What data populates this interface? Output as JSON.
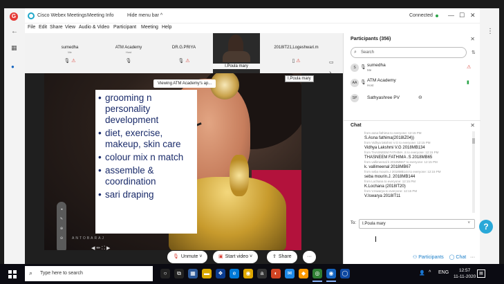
{
  "window": {
    "app_title": "Cisco Webex Meetings",
    "meeting_info": "Meeting Info",
    "hide_menu": "Hide menu bar ^",
    "connection": "Connected",
    "minimize": "—",
    "maximize": "☐",
    "close": "✕"
  },
  "menu": [
    "File",
    "Edit",
    "Share",
    "View",
    "Audio & Video",
    "Participant",
    "Meeting",
    "Help"
  ],
  "thumbnails": [
    {
      "name": "sumedha",
      "role": "Me"
    },
    {
      "name": "ATM Academy",
      "role": "Host"
    },
    {
      "name": "DR.G.PRIYA",
      "role": ""
    },
    {
      "name": "I.Poula mary",
      "role": ""
    },
    {
      "name": "2018IT21,Logeshwari.m",
      "role": ""
    }
  ],
  "stage": {
    "viewing_banner": "Viewing ATM Academy's ap...",
    "hover_tip": "I.Poula mary",
    "watermark": "ANTOBARAJ"
  },
  "slide": {
    "bullets": [
      "grooming n personality development",
      "diet, exercise, makeup, skin care",
      "colour mix n match",
      " assemble & coordination",
      "sari draping"
    ]
  },
  "controls": {
    "unmute": "Unmute",
    "start_video": "Start video",
    "share": "Share",
    "more": "···",
    "end": "✕",
    "participants": "Participants",
    "chat": "Chat"
  },
  "participants_panel": {
    "title": "Participants (356)",
    "search_placeholder": "Search",
    "list": [
      {
        "initials": "S",
        "name": "sumedha",
        "role": "Me"
      },
      {
        "initials": "AA",
        "name": "ATM Academy",
        "role": "Host"
      },
      {
        "initials": "SP",
        "name": "Sathyashree PV",
        "role": ""
      }
    ]
  },
  "chat_panel": {
    "title": "Chat",
    "messages": [
      {
        "from": "from asna fathima to everyone:   12:15 PM",
        "text": "S.Asna fathima(2018IZ04))"
      },
      {
        "from": "from Vidhya lakshmi V.G to everyone:   12:15 PM",
        "text": "Vidhya Lakshmi V.G 2018MB134"
      },
      {
        "from": "from THASNEEM FATHIMA .S to everyone:   12:15 PM",
        "text": "THASNEEM FATHIMA .S  2018MB65"
      },
      {
        "from": "from vallimeenal k 2018MB67 to everyone:   12:15 PM",
        "text": "k. vallimeenal 2018MB67"
      },
      {
        "from": "from seba mourin.J 2018MB144 to everyone:   12:15 PM",
        "text": "seba mourin.J. 2018MB144"
      },
      {
        "from": "from Lochana to everyone:   12:15 PM",
        "text": "K.Lochana (2018IT20)"
      },
      {
        "from": "from V.Iswarya to everyone:   12:15 PM",
        "text": "V.Iswarya 2018IT11"
      }
    ],
    "to_label": "To:",
    "to_value": "I.Poula mary"
  },
  "taskbar": {
    "search_placeholder": "Type here to search",
    "lang": "ENG",
    "time": "12:57",
    "date": "11-11-2020"
  },
  "colors": {
    "accent": "#1a7ec9",
    "end_red": "#e03a3a",
    "connected_green": "#2ca54a",
    "slide_text": "#1a2b6a"
  }
}
